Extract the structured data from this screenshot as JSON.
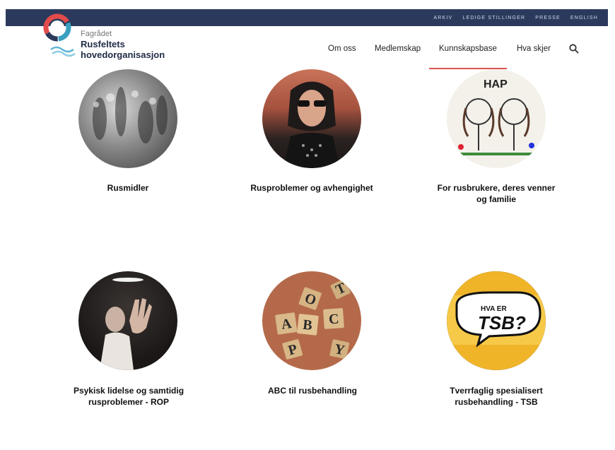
{
  "topbar": {
    "links": [
      "ARKIV",
      "LEDIGE STILLINGER",
      "PRESSE",
      "ENGLISH"
    ]
  },
  "brand": {
    "line1": "Fagrådet",
    "line2": "Rusfeltets",
    "line3": "hovedorganisasjon"
  },
  "nav": {
    "items": [
      "Om oss",
      "Medlemskap",
      "Kunnskapsbase",
      "Hva skjer"
    ],
    "active_index": 2
  },
  "cards": [
    {
      "label_line1": "Rusmidler",
      "label_line2": ""
    },
    {
      "label_line1": "Rusproblemer og avhengighet",
      "label_line2": ""
    },
    {
      "label_line1": "For rusbrukere, deres venner",
      "label_line2": "og familie"
    },
    {
      "label_line1": "Psykisk lidelse og samtidig",
      "label_line2": "rusproblemer - ROP"
    },
    {
      "label_line1": "ABC til rusbehandling",
      "label_line2": ""
    },
    {
      "label_line1": "Tverrfaglig spesialisert",
      "label_line2": "rusbehandling - TSB"
    }
  ],
  "tsb_image_text": {
    "line1": "HVA ER",
    "line2": "TSB?"
  },
  "hap_text": "HAP",
  "colors": {
    "topbar": "#2b3a5c",
    "accent": "#d9534f",
    "brand_text": "#1f2b44"
  },
  "icons": {
    "search": "search-icon",
    "logo": "logo-ring-icon"
  }
}
